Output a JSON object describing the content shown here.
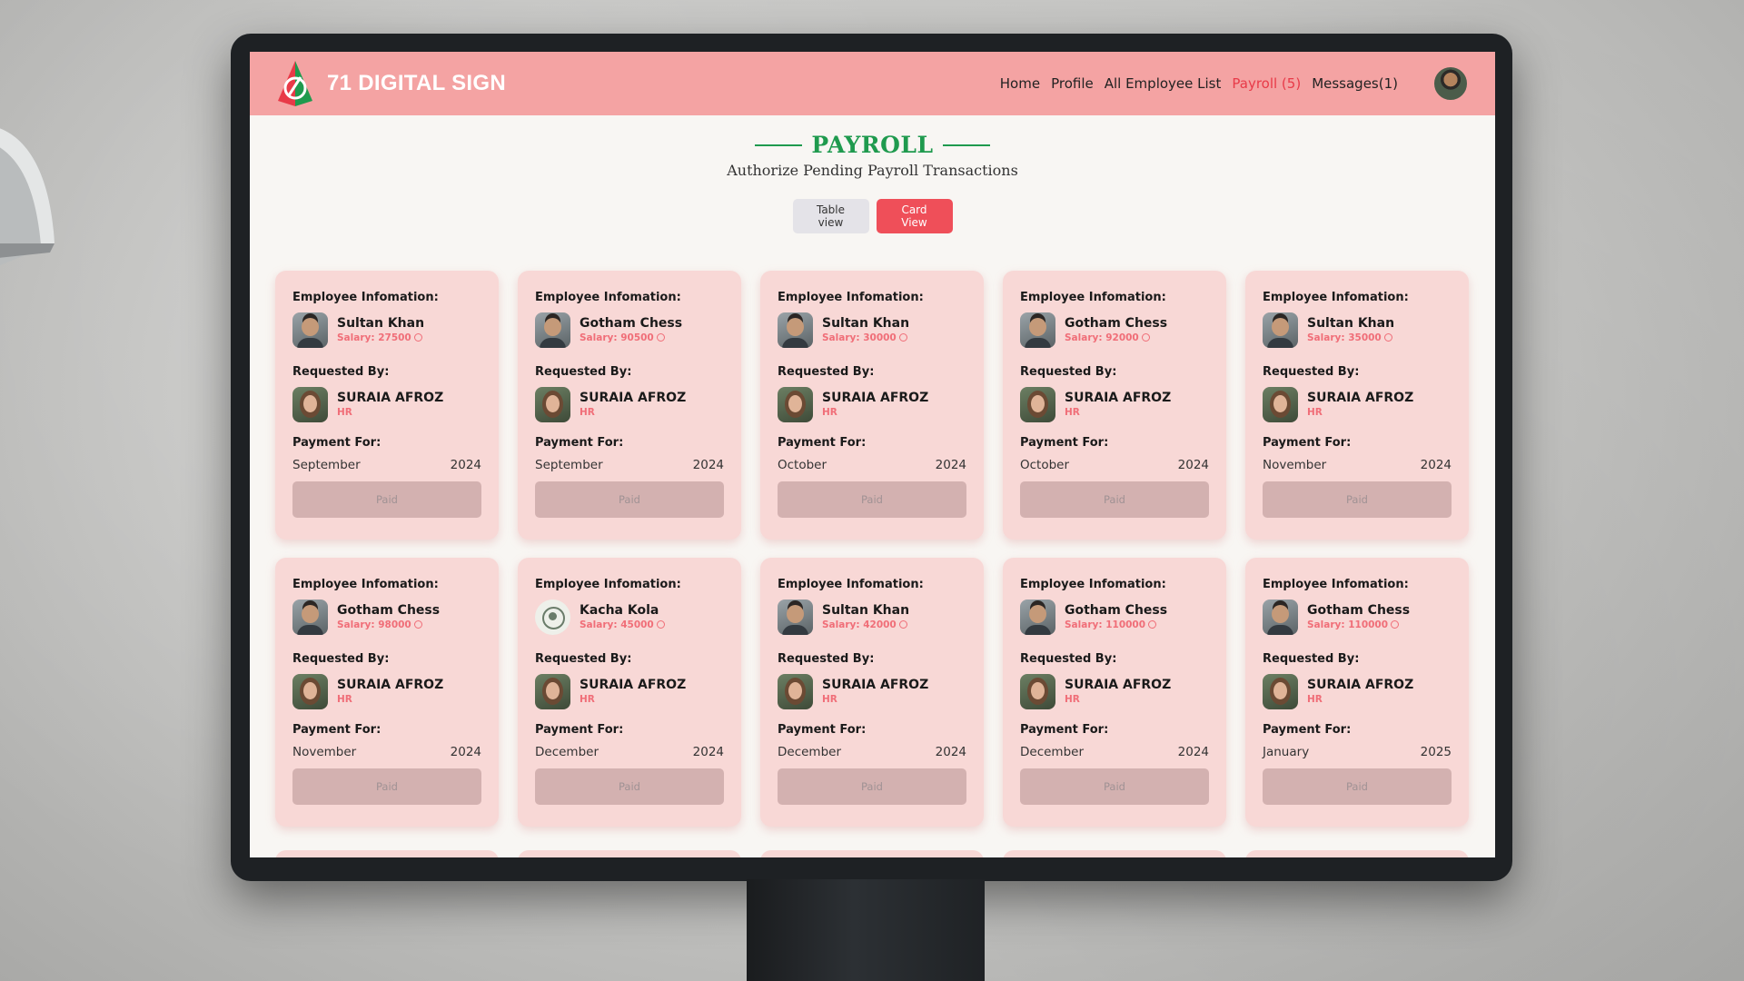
{
  "app": {
    "brand": "71 DIGITAL SIGN",
    "nav": [
      {
        "label": "Home",
        "active": false
      },
      {
        "label": "Profile",
        "active": false
      },
      {
        "label": "All Employee List",
        "active": false
      },
      {
        "label": "Payroll (5)",
        "active": true
      },
      {
        "label": "Messages(1)",
        "active": false
      }
    ]
  },
  "page": {
    "title": "PAYROLL",
    "subtitle": "Authorize Pending Payroll Transactions",
    "view_buttons": {
      "table": "Table view",
      "card": "Card View"
    }
  },
  "labels": {
    "employee_info": "Employee Infomation:",
    "requested_by": "Requested By:",
    "payment_for": "Payment For:",
    "paid_button": "Paid"
  },
  "cards": [
    {
      "employee": "Sultan Khan",
      "salary": "Salary: 27500",
      "photo": "man",
      "requester": "SURAIA AFROZ",
      "role": "HR",
      "month": "September",
      "year": "2024"
    },
    {
      "employee": "Gotham Chess",
      "salary": "Salary: 90500",
      "photo": "man",
      "requester": "SURAIA AFROZ",
      "role": "HR",
      "month": "September",
      "year": "2024"
    },
    {
      "employee": "Sultan Khan",
      "salary": "Salary: 30000",
      "photo": "man",
      "requester": "SURAIA AFROZ",
      "role": "HR",
      "month": "October",
      "year": "2024"
    },
    {
      "employee": "Gotham Chess",
      "salary": "Salary: 92000",
      "photo": "man",
      "requester": "SURAIA AFROZ",
      "role": "HR",
      "month": "October",
      "year": "2024"
    },
    {
      "employee": "Sultan Khan",
      "salary": "Salary: 35000",
      "photo": "man",
      "requester": "SURAIA AFROZ",
      "role": "HR",
      "month": "November",
      "year": "2024"
    },
    {
      "employee": "Gotham Chess",
      "salary": "Salary: 98000",
      "photo": "man",
      "requester": "SURAIA AFROZ",
      "role": "HR",
      "month": "November",
      "year": "2024"
    },
    {
      "employee": "Kacha Kola",
      "salary": "Salary: 45000",
      "photo": "logo",
      "requester": "SURAIA AFROZ",
      "role": "HR",
      "month": "December",
      "year": "2024"
    },
    {
      "employee": "Sultan Khan",
      "salary": "Salary: 42000",
      "photo": "man",
      "requester": "SURAIA AFROZ",
      "role": "HR",
      "month": "December",
      "year": "2024"
    },
    {
      "employee": "Gotham Chess",
      "salary": "Salary: 110000",
      "photo": "man",
      "requester": "SURAIA AFROZ",
      "role": "HR",
      "month": "December",
      "year": "2024"
    },
    {
      "employee": "Gotham Chess",
      "salary": "Salary: 110000",
      "photo": "man",
      "requester": "SURAIA AFROZ",
      "role": "HR",
      "month": "January",
      "year": "2025"
    }
  ],
  "colors": {
    "header_bg": "#f4a3a3",
    "brand_green": "#1f9a4e",
    "accent_red": "#ef4f59",
    "card_bg": "#f8d8d6",
    "salary_text": "#f06e78"
  }
}
